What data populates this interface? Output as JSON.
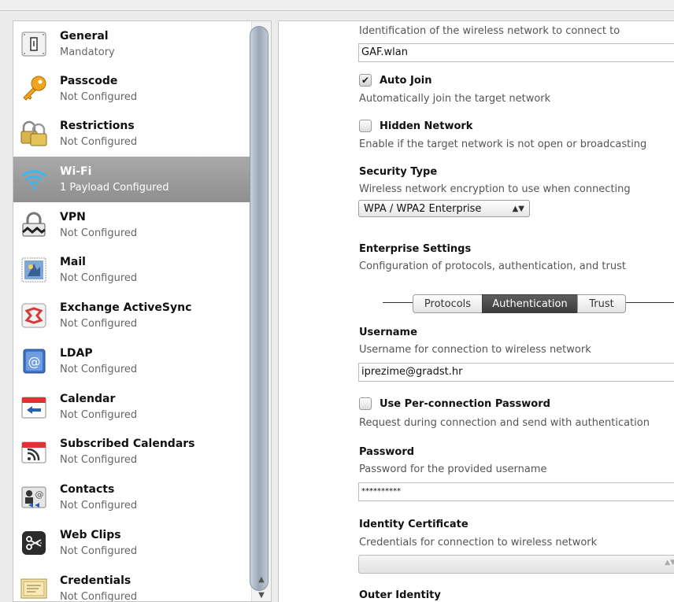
{
  "sidebar": {
    "items": [
      {
        "title": "General",
        "sub": "Mandatory",
        "icon": "general-icon"
      },
      {
        "title": "Passcode",
        "sub": "Not Configured",
        "icon": "key-icon"
      },
      {
        "title": "Restrictions",
        "sub": "Not Configured",
        "icon": "padlocks-icon"
      },
      {
        "title": "Wi-Fi",
        "sub": "1 Payload Configured",
        "icon": "wifi-icon"
      },
      {
        "title": "VPN",
        "sub": "Not Configured",
        "icon": "vpn-lock-icon"
      },
      {
        "title": "Mail",
        "sub": "Not Configured",
        "icon": "mail-stamp-icon"
      },
      {
        "title": "Exchange ActiveSync",
        "sub": "Not Configured",
        "icon": "exchange-icon"
      },
      {
        "title": "LDAP",
        "sub": "Not Configured",
        "icon": "ldap-at-icon"
      },
      {
        "title": "Calendar",
        "sub": "Not Configured",
        "icon": "calendar-icon"
      },
      {
        "title": "Subscribed Calendars",
        "sub": "Not Configured",
        "icon": "subscribed-calendar-icon"
      },
      {
        "title": "Contacts",
        "sub": "Not Configured",
        "icon": "contacts-icon"
      },
      {
        "title": "Web Clips",
        "sub": "Not Configured",
        "icon": "scissors-icon"
      },
      {
        "title": "Credentials",
        "sub": "Not Configured",
        "icon": "certificate-icon"
      }
    ]
  },
  "main": {
    "ssid_desc": "Identification of the wireless network to connect to",
    "ssid_value": "GAF.wlan",
    "auto_join_label": "Auto Join",
    "auto_join_checked": true,
    "auto_join_desc": "Automatically join the target network",
    "hidden_label": "Hidden Network",
    "hidden_checked": false,
    "hidden_desc": "Enable if the target network is not open or broadcasting",
    "security_label": "Security Type",
    "security_desc": "Wireless network encryption to use when connecting",
    "security_value": "WPA / WPA2 Enterprise",
    "enterprise_label": "Enterprise Settings",
    "enterprise_desc": "Configuration of protocols, authentication, and trust",
    "tabs": [
      "Protocols",
      "Authentication",
      "Trust"
    ],
    "active_tab": "Authentication",
    "username_label": "Username",
    "username_desc": "Username for connection to wireless network",
    "username_value": "iprezime@gradst.hr",
    "per_conn_label": "Use Per-connection Password",
    "per_conn_checked": false,
    "per_conn_desc": "Request during connection and send with authentication",
    "password_label": "Password",
    "password_desc": "Password for the provided username",
    "password_value": "**********",
    "identity_cert_label": "Identity Certificate",
    "identity_cert_desc": "Credentials for connection to wireless network",
    "identity_cert_value": "",
    "outer_identity_label": "Outer Identity"
  },
  "colors": {
    "selected_row": "#9a9a9a",
    "active_tab": "#4a4a4a"
  }
}
